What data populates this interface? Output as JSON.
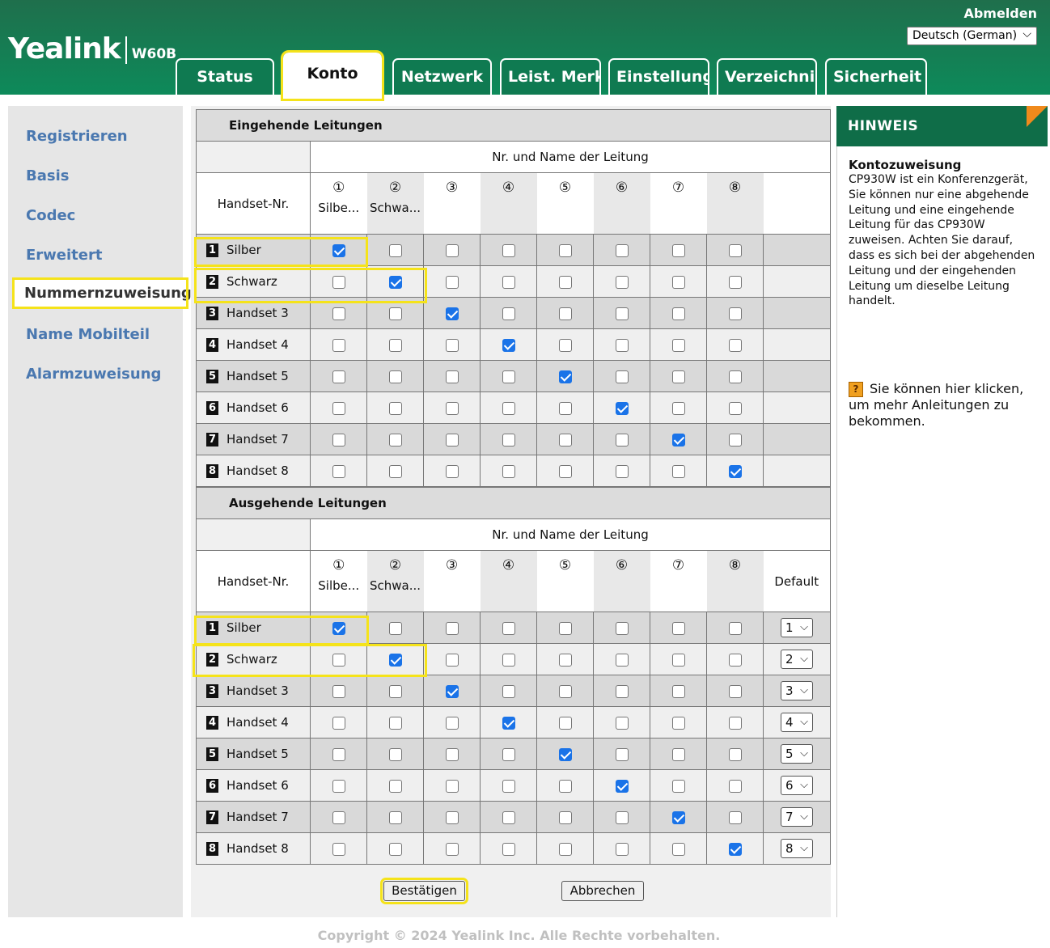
{
  "header": {
    "brand": "Yealink",
    "model": "W60B",
    "logout": "Abmelden",
    "language": "Deutsch (German)",
    "tabs": [
      "Status",
      "Konto",
      "Netzwerk",
      "Leist. Merk",
      "Einstellung",
      "Verzeichni",
      "Sicherheit"
    ],
    "active_tab": "Konto"
  },
  "sidebar": {
    "items": [
      "Registrieren",
      "Basis",
      "Codec",
      "Erweitert",
      "Nummernzuweisung",
      "Name Mobilteil",
      "Alarmzuweisung"
    ],
    "active": "Nummernzuweisung"
  },
  "incoming": {
    "title": "Eingehende Leitungen",
    "line_header": "Nr. und Name der Leitung",
    "handset_header": "Handset-Nr.",
    "columns": [
      {
        "num": "①",
        "name": "Silbe..."
      },
      {
        "num": "②",
        "name": "Schwa..."
      },
      {
        "num": "③",
        "name": ""
      },
      {
        "num": "④",
        "name": ""
      },
      {
        "num": "⑤",
        "name": ""
      },
      {
        "num": "⑥",
        "name": ""
      },
      {
        "num": "⑦",
        "name": ""
      },
      {
        "num": "⑧",
        "name": ""
      }
    ],
    "rows": [
      {
        "num": "1",
        "name": "Silber",
        "checked": 1
      },
      {
        "num": "2",
        "name": "Schwarz",
        "checked": 2
      },
      {
        "num": "3",
        "name": "Handset 3",
        "checked": 3
      },
      {
        "num": "4",
        "name": "Handset 4",
        "checked": 4
      },
      {
        "num": "5",
        "name": "Handset 5",
        "checked": 5
      },
      {
        "num": "6",
        "name": "Handset 6",
        "checked": 6
      },
      {
        "num": "7",
        "name": "Handset 7",
        "checked": 7
      },
      {
        "num": "8",
        "name": "Handset 8",
        "checked": 8
      }
    ]
  },
  "outgoing": {
    "title": "Ausgehende Leitungen",
    "line_header": "Nr. und Name der Leitung",
    "handset_header": "Handset-Nr.",
    "default_header": "Default",
    "rows": [
      {
        "num": "1",
        "name": "Silber",
        "checked": 1,
        "default": "1"
      },
      {
        "num": "2",
        "name": "Schwarz",
        "checked": 2,
        "default": "2"
      },
      {
        "num": "3",
        "name": "Handset 3",
        "checked": 3,
        "default": "3"
      },
      {
        "num": "4",
        "name": "Handset 4",
        "checked": 4,
        "default": "4"
      },
      {
        "num": "5",
        "name": "Handset 5",
        "checked": 5,
        "default": "5"
      },
      {
        "num": "6",
        "name": "Handset 6",
        "checked": 6,
        "default": "6"
      },
      {
        "num": "7",
        "name": "Handset 7",
        "checked": 7,
        "default": "7"
      },
      {
        "num": "8",
        "name": "Handset 8",
        "checked": 8,
        "default": "8"
      }
    ]
  },
  "buttons": {
    "confirm": "Bestätigen",
    "cancel": "Abbrechen"
  },
  "note": {
    "header": "HINWEIS",
    "title": "Kontozuweisung",
    "text": "CP930W ist ein Konferenzgerät, Sie können nur eine abgehende Leitung und eine eingehende Leitung für das CP930W zuweisen. Achten Sie darauf, dass es sich bei der abgehenden Leitung und der eingehenden Leitung um dieselbe Leitung handelt.",
    "help_icon_text": "?",
    "help": "Sie können hier klicken, um mehr Anleitungen zu bekommen."
  },
  "footer": "Copyright © 2024 Yealink Inc. Alle Rechte vorbehalten.",
  "colors": {
    "header_green": "#0f7a51",
    "highlight_yellow": "#f5e31a",
    "link_blue": "#4a78b0",
    "checkbox_blue": "#1a73e8"
  }
}
